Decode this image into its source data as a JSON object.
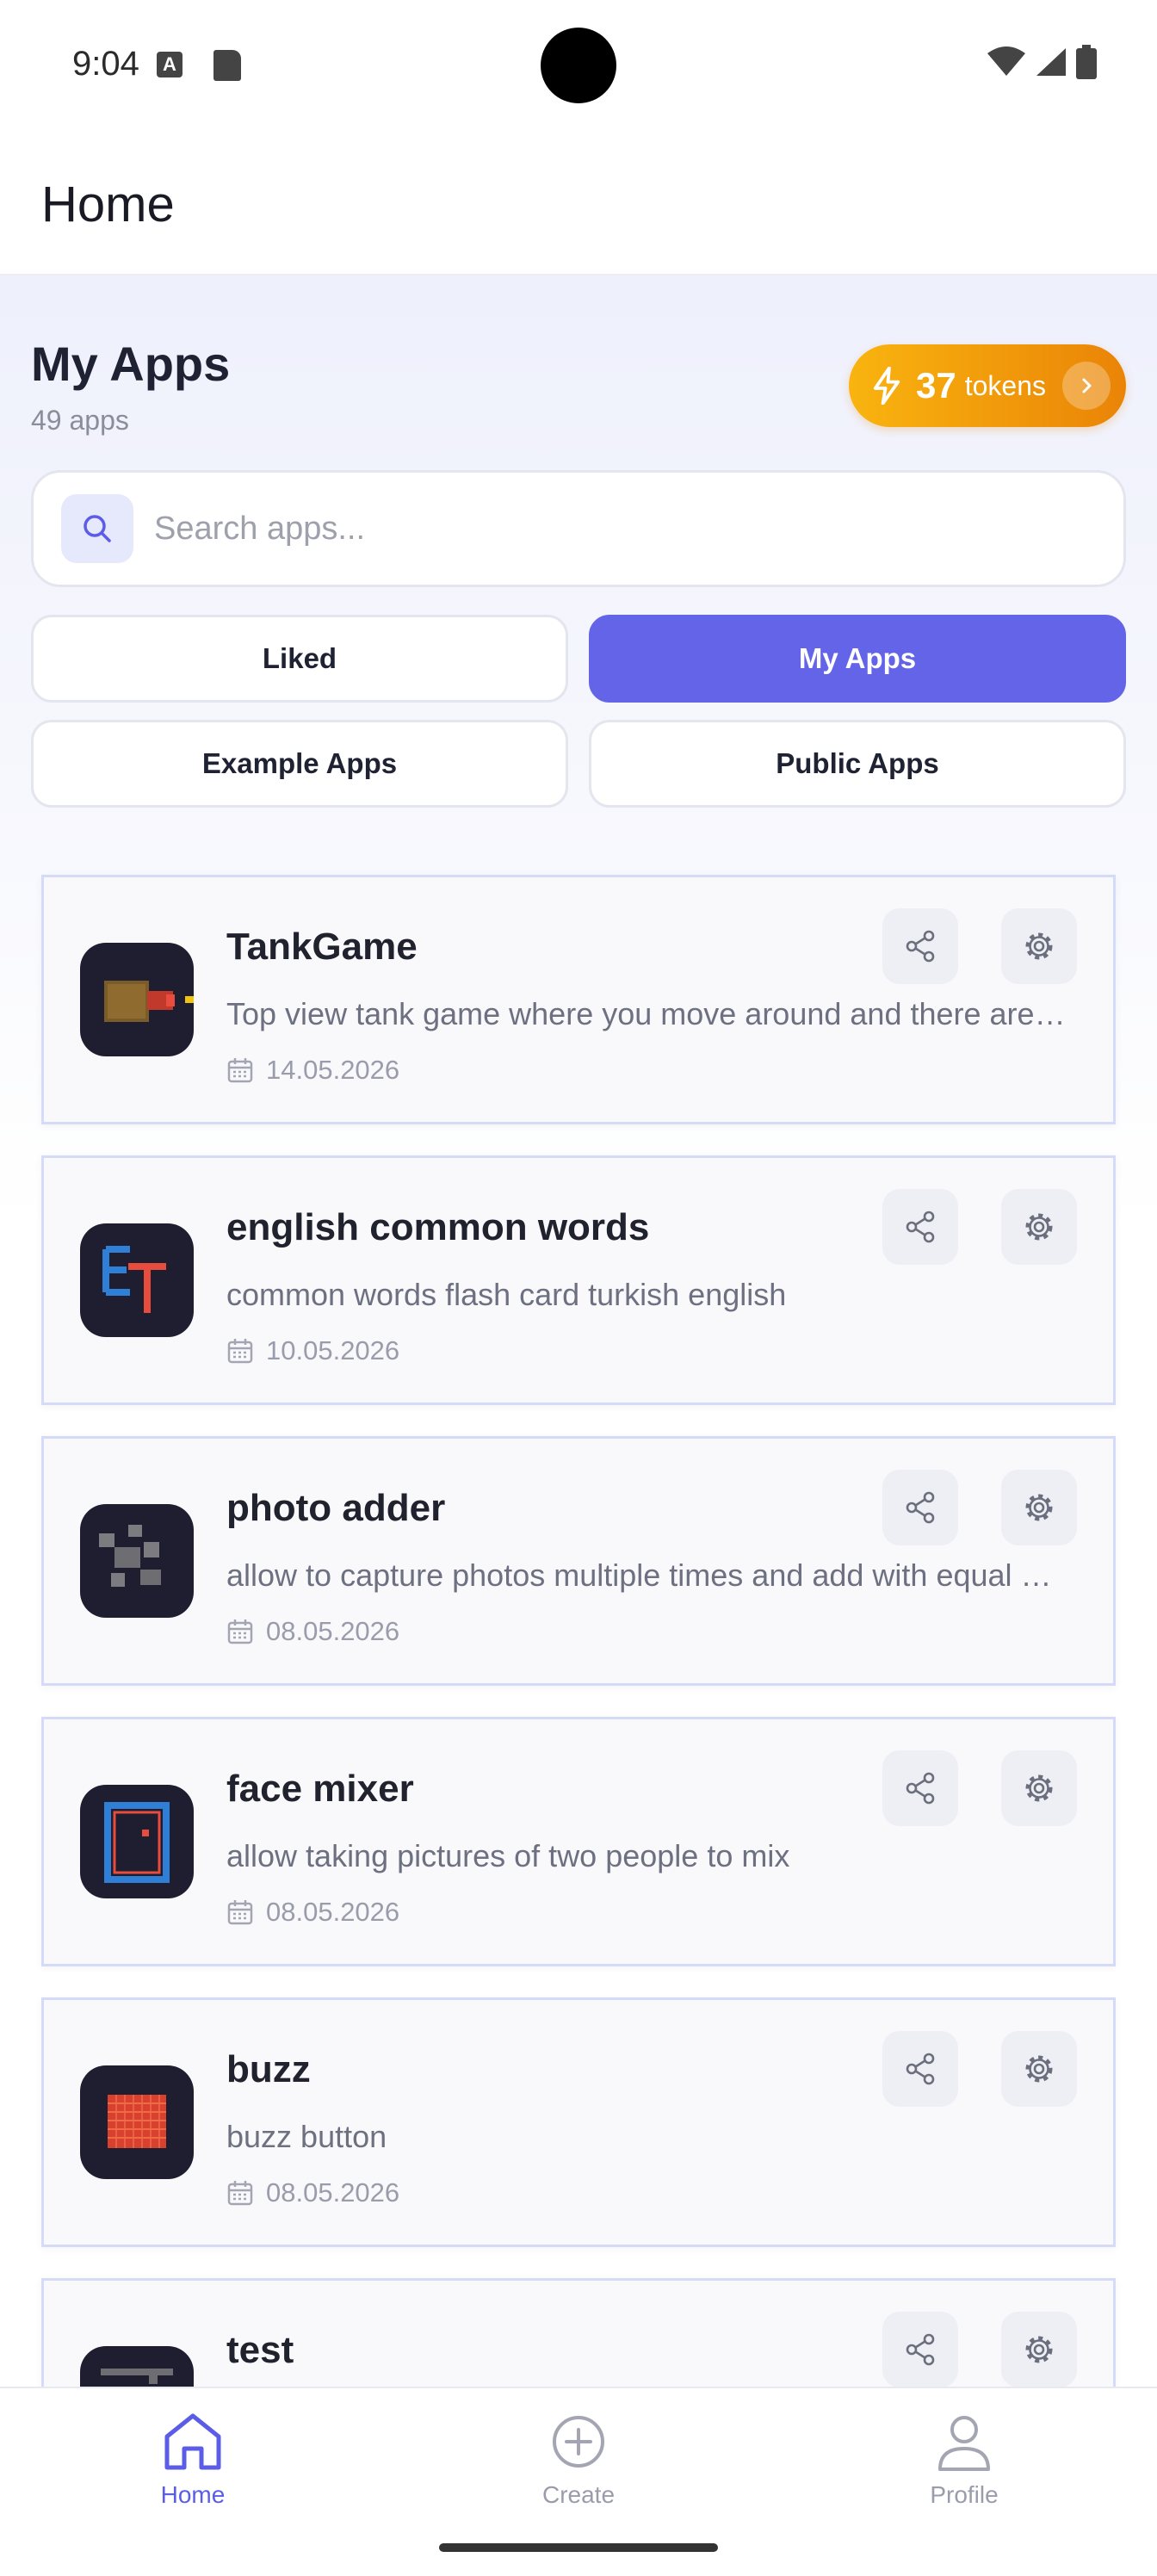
{
  "status_bar": {
    "time": "9:04",
    "a_badge": "A"
  },
  "header": {
    "title": "Home"
  },
  "section": {
    "title": "My Apps",
    "count": "49 apps"
  },
  "tokens": {
    "count": "37",
    "label": "tokens"
  },
  "search": {
    "placeholder": "Search apps..."
  },
  "filters": [
    {
      "label": "Liked",
      "active": false
    },
    {
      "label": "My Apps",
      "active": true
    },
    {
      "label": "Example Apps",
      "active": false
    },
    {
      "label": "Public Apps",
      "active": false
    }
  ],
  "apps": [
    {
      "title": "TankGame",
      "description": "Top view tank game where you move around and there are enemies",
      "date": "14.05.2026",
      "icon": "tank-icon"
    },
    {
      "title": "english common words",
      "description": "common words flash card turkish english",
      "date": "10.05.2026",
      "icon": "letters-et-icon"
    },
    {
      "title": "photo adder",
      "description": "allow to capture photos multiple times and add with equal weight",
      "date": "08.05.2026",
      "icon": "photo-blocks-icon"
    },
    {
      "title": "face mixer",
      "description": "allow taking pictures of two people to mix",
      "date": "08.05.2026",
      "icon": "face-frame-icon"
    },
    {
      "title": "buzz",
      "description": "buzz button",
      "date": "08.05.2026",
      "icon": "red-grid-icon"
    },
    {
      "title": "test",
      "description": "",
      "date": "",
      "icon": "test-icon"
    }
  ],
  "nav": [
    {
      "label": "Home",
      "icon": "home-icon",
      "active": true
    },
    {
      "label": "Create",
      "icon": "plus-circle-icon",
      "active": false
    },
    {
      "label": "Profile",
      "icon": "person-icon",
      "active": false
    }
  ],
  "colors": {
    "accent": "#6364e8",
    "tokens_start": "#f9b40f",
    "tokens_end": "#ea8407",
    "card_border": "#d5dbf6",
    "icon_bg": "#1e1e30"
  }
}
